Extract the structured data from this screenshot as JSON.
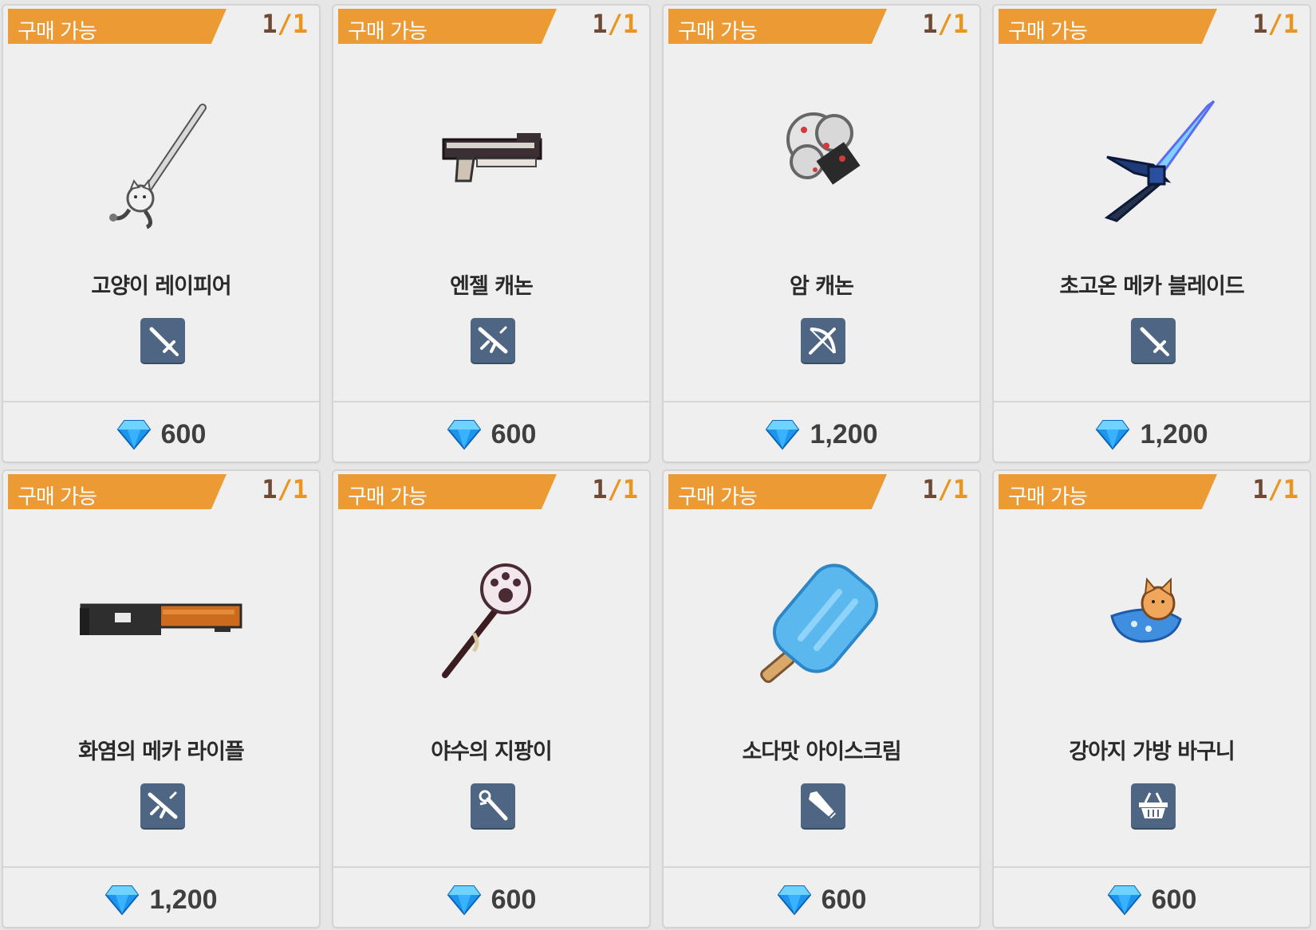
{
  "theme": {
    "banner_color": "#ec9a33",
    "badge_color": "#4e6683",
    "gem_color": "#1fa3f2"
  },
  "items": [
    {
      "banner": "구매 가능",
      "stock_current": "1",
      "stock_sep": "/",
      "stock_max": "1",
      "name": "고양이 레이피어",
      "category_icon": "sword-icon",
      "currency_icon": "diamond-icon",
      "price": "600"
    },
    {
      "banner": "구매 가능",
      "stock_current": "1",
      "stock_sep": "/",
      "stock_max": "1",
      "name": "엔젤 캐논",
      "category_icon": "rifle-icon",
      "currency_icon": "diamond-icon",
      "price": "600"
    },
    {
      "banner": "구매 가능",
      "stock_current": "1",
      "stock_sep": "/",
      "stock_max": "1",
      "name": "암 캐논",
      "category_icon": "bow-icon",
      "currency_icon": "diamond-icon",
      "price": "1,200"
    },
    {
      "banner": "구매 가능",
      "stock_current": "1",
      "stock_sep": "/",
      "stock_max": "1",
      "name": "초고온 메카 블레이드",
      "category_icon": "sword-icon",
      "currency_icon": "diamond-icon",
      "price": "1,200"
    },
    {
      "banner": "구매 가능",
      "stock_current": "1",
      "stock_sep": "/",
      "stock_max": "1",
      "name": "화염의 메카 라이플",
      "category_icon": "rifle-icon",
      "currency_icon": "diamond-icon",
      "price": "1,200"
    },
    {
      "banner": "구매 가능",
      "stock_current": "1",
      "stock_sep": "/",
      "stock_max": "1",
      "name": "야수의 지팡이",
      "category_icon": "staff-icon",
      "currency_icon": "diamond-icon",
      "price": "600"
    },
    {
      "banner": "구매 가능",
      "stock_current": "1",
      "stock_sep": "/",
      "stock_max": "1",
      "name": "소다맛 아이스크림",
      "category_icon": "greatsword-icon",
      "currency_icon": "diamond-icon",
      "price": "600"
    },
    {
      "banner": "구매 가능",
      "stock_current": "1",
      "stock_sep": "/",
      "stock_max": "1",
      "name": "강아지 가방 바구니",
      "category_icon": "basket-icon",
      "currency_icon": "diamond-icon",
      "price": "600"
    }
  ]
}
